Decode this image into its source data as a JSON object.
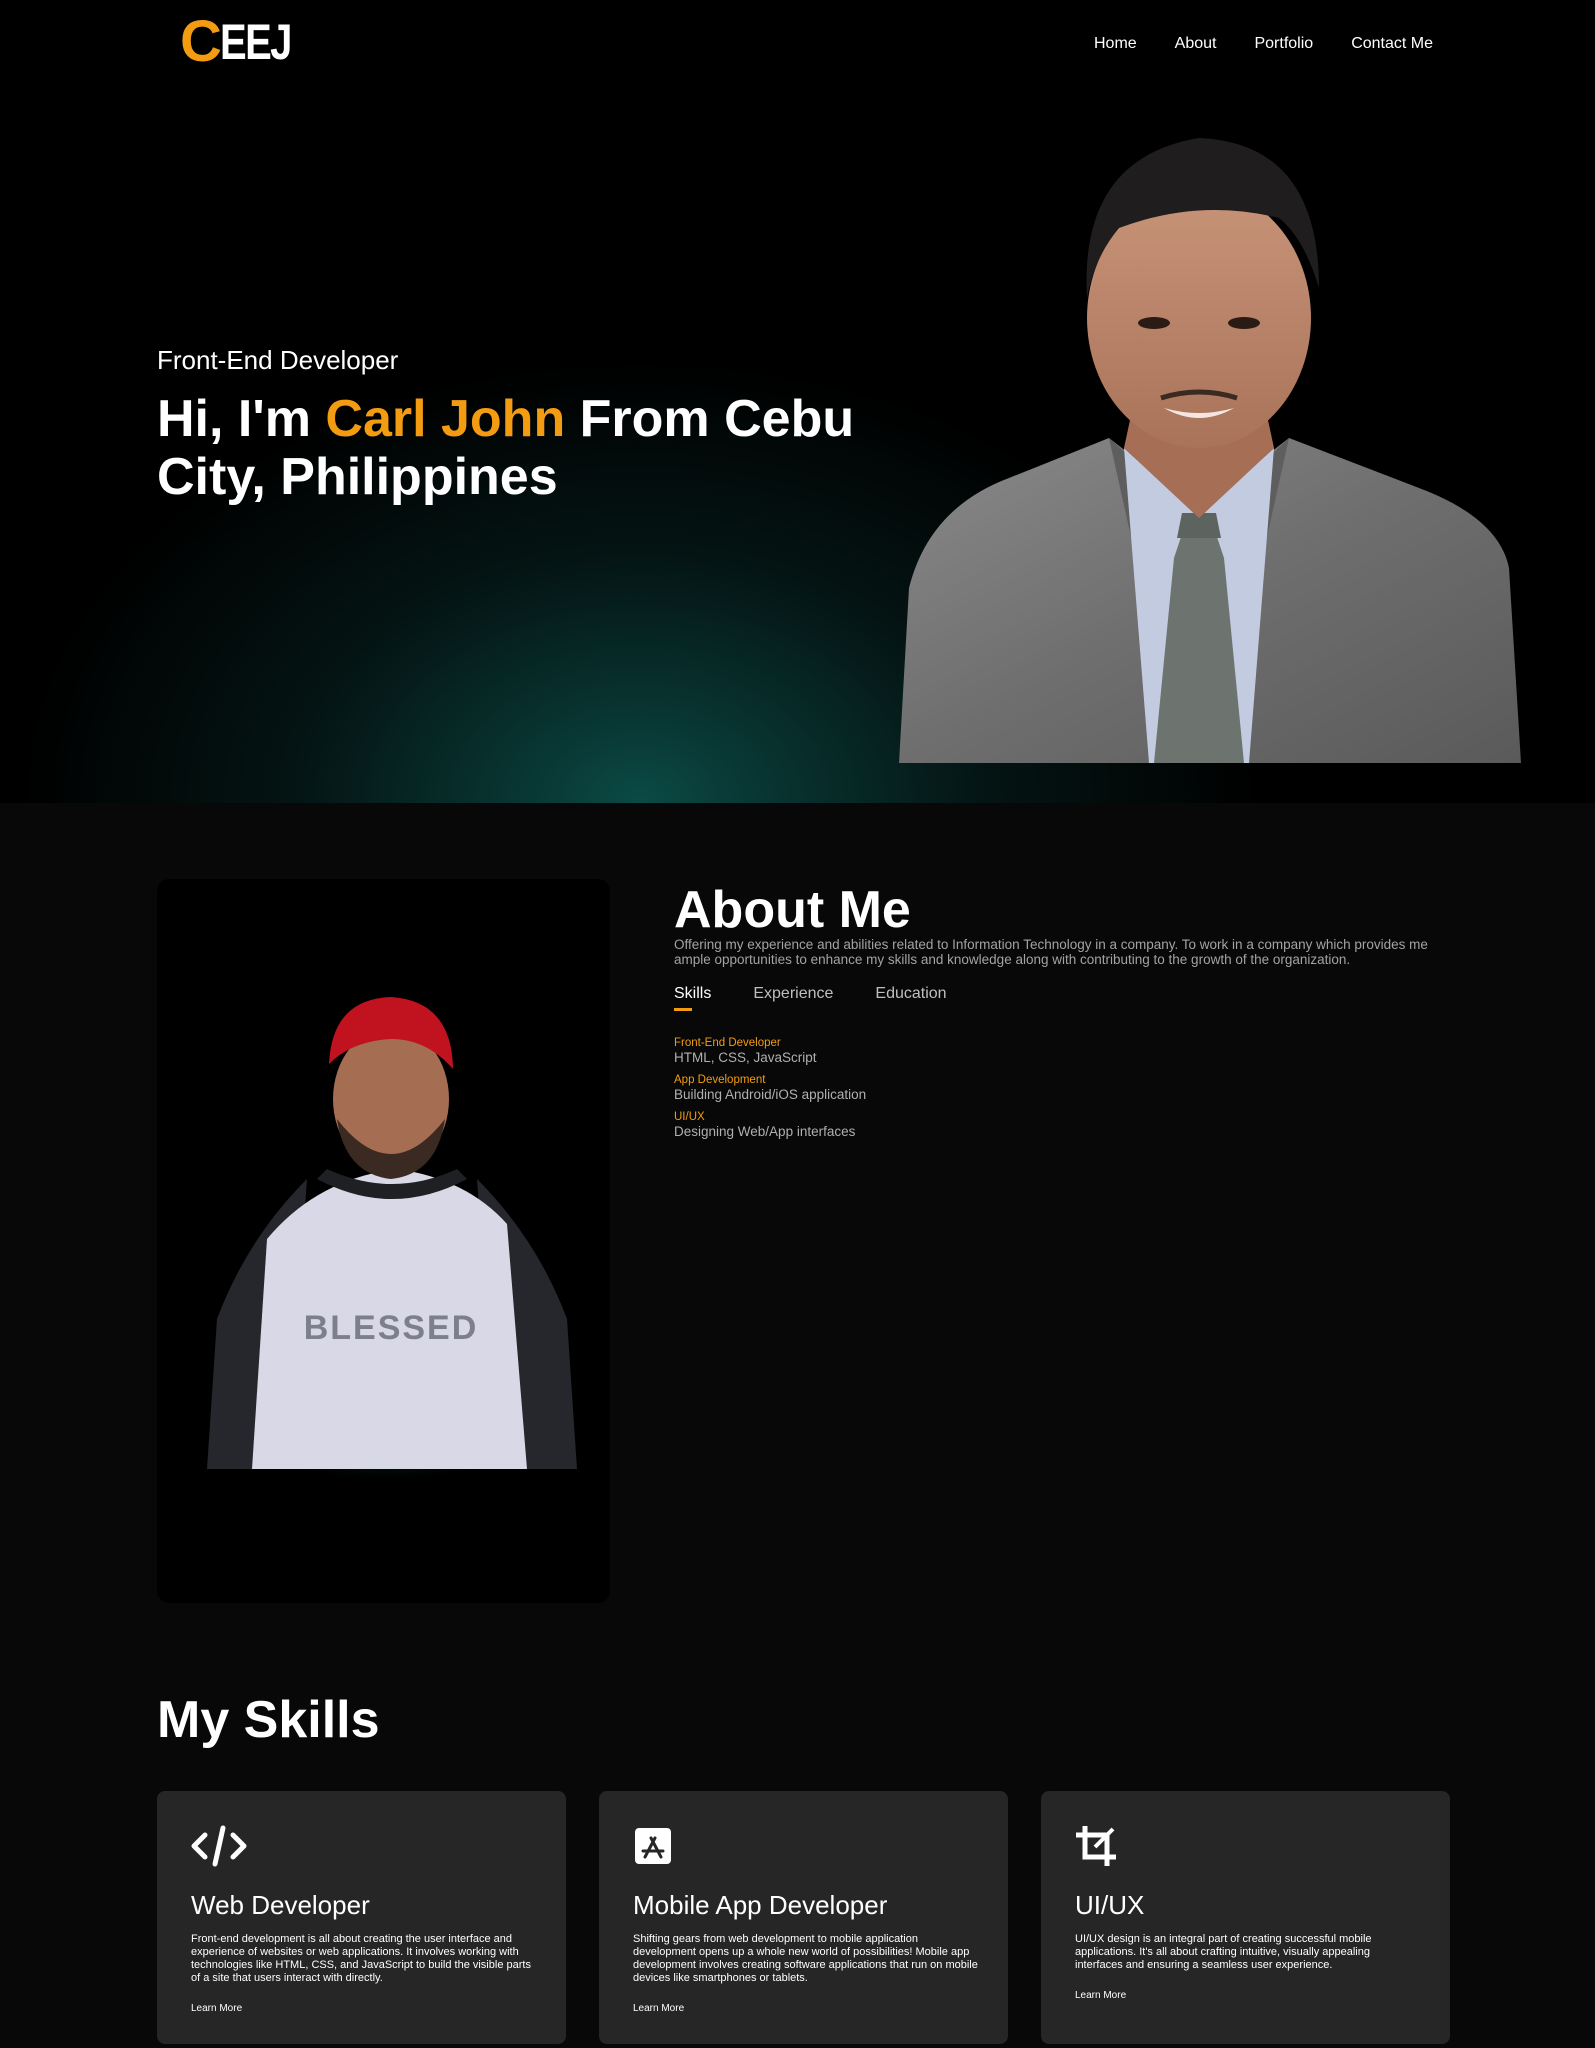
{
  "header": {
    "logo_first": "C",
    "logo_rest": "EEJ",
    "nav": [
      "Home",
      "About",
      "Portfolio",
      "Contact Me"
    ]
  },
  "hero": {
    "subtitle": "Front-End Developer",
    "title_pre": "Hi, I'm ",
    "title_name": "Carl John",
    "title_post": " From Cebu City, Philippines"
  },
  "about": {
    "title": "About Me",
    "description": "Offering my experience and abilities related to Information Technology in a company. To work in a company which provides me ample opportunities to enhance my skills and knowledge along with contributing to the growth of the organization.",
    "tabs": [
      "Skills",
      "Experience",
      "Education"
    ],
    "active_tab": "Skills",
    "skills": [
      {
        "title": "Front-End Developer",
        "detail": "HTML, CSS, JavaScript"
      },
      {
        "title": "App Development",
        "detail": "Building Android/iOS application"
      },
      {
        "title": "UI/UX",
        "detail": "Designing Web/App interfaces"
      }
    ],
    "photo_shirt_text": "BLESSED"
  },
  "my_skills": {
    "title": "My Skills",
    "cards": [
      {
        "icon": "code-icon",
        "title": "Web Developer",
        "text": "Front-end development is all about creating the user interface and experience of websites or web applications. It involves working with technologies like HTML, CSS, and JavaScript to build the visible parts of a site that users interact with directly.",
        "link": "Learn More"
      },
      {
        "icon": "app-store-icon",
        "title": "Mobile App Developer",
        "text": "Shifting gears from web development to mobile application development opens up a whole new world of possibilities! Mobile app development involves creating software applications that run on mobile devices like smartphones or tablets.",
        "link": "Learn More"
      },
      {
        "icon": "crop-icon",
        "title": "UI/UX",
        "text": "UI/UX design is an integral part of creating successful mobile applications. It's all about crafting intuitive, visually appealing interfaces and ensuring a seamless user experience.",
        "link": "Learn More"
      }
    ]
  },
  "colors": {
    "accent": "#f39c12",
    "background": "#080808",
    "card": "#262626",
    "hero_glow": "#0b4a45"
  }
}
